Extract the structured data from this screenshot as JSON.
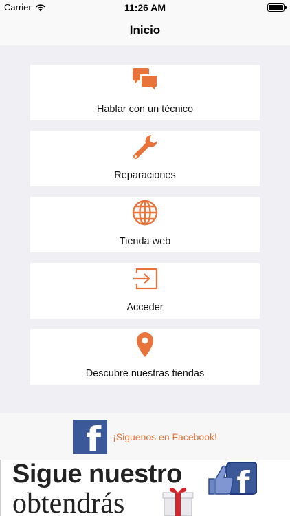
{
  "status_bar": {
    "carrier": "Carrier",
    "time": "11:26 AM"
  },
  "nav": {
    "title": "Inicio"
  },
  "colors": {
    "accent": "#e8743b",
    "facebook": "#3b5998",
    "background": "#efeff4"
  },
  "menu": [
    {
      "label": "Hablar con un técnico",
      "icon": "chat-bubbles-icon"
    },
    {
      "label": "Reparaciones",
      "icon": "wrench-icon"
    },
    {
      "label": "Tienda web",
      "icon": "globe-icon"
    },
    {
      "label": "Acceder",
      "icon": "sign-in-icon"
    },
    {
      "label": "Descubre nuestras tiendas",
      "icon": "map-pin-icon"
    }
  ],
  "facebook": {
    "text": "¡Siguenos en Facebook!",
    "logo_letter": "f"
  },
  "banner": {
    "line1": "Sigue nuestro",
    "line2": "obtendrás"
  }
}
